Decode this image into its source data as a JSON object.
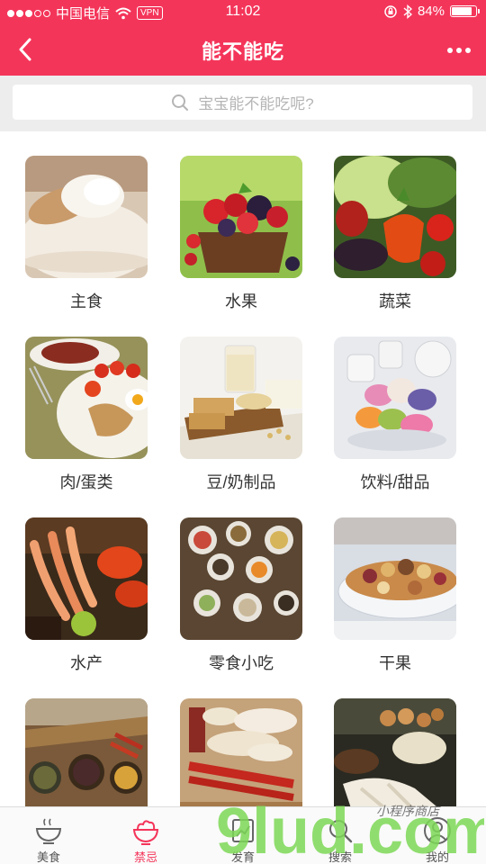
{
  "status_bar": {
    "carrier": "中国电信",
    "vpn": "VPN",
    "time": "11:02",
    "battery": "84%",
    "battery_level": 0.84
  },
  "nav": {
    "title": "能不能吃"
  },
  "search": {
    "placeholder": "宝宝能不能吃呢?"
  },
  "categories": [
    {
      "label": "主食"
    },
    {
      "label": "水果"
    },
    {
      "label": "蔬菜"
    },
    {
      "label": "肉/蛋类"
    },
    {
      "label": "豆/奶制品"
    },
    {
      "label": "饮料/甜品"
    },
    {
      "label": "水产"
    },
    {
      "label": "零食小吃"
    },
    {
      "label": "干果"
    },
    {
      "label": ""
    },
    {
      "label": ""
    },
    {
      "label": ""
    }
  ],
  "tabbar": {
    "items": [
      {
        "label": "美食"
      },
      {
        "label": "禁忌"
      },
      {
        "label": "发育"
      },
      {
        "label": "搜索"
      },
      {
        "label": "我的"
      }
    ],
    "active_index": 1
  },
  "watermark": {
    "big": "9lud.com",
    "small": "小程序商店"
  },
  "colors": {
    "accent": "#f4355a"
  }
}
